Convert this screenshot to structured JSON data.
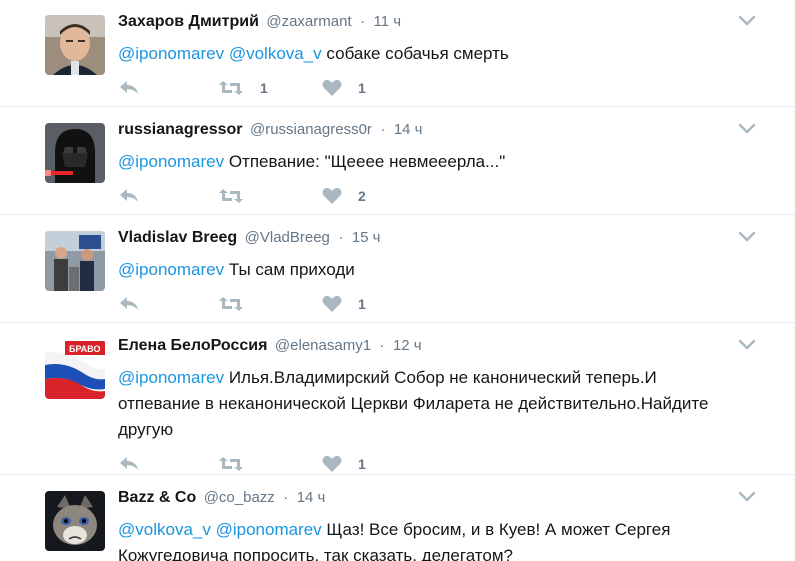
{
  "tweets": [
    {
      "fullname": "Захаров Дмитрий",
      "username": "@zaxarmant",
      "separator": "·",
      "time": "11 ч",
      "mentions": [
        "@iponomarev",
        "@volkova_v"
      ],
      "text": "собаке собачья смерть",
      "text_lines": [],
      "retweets": "1",
      "likes": "1",
      "avatar": "man-photo"
    },
    {
      "fullname": "russianagressor",
      "username": "@russianagress0r",
      "separator": "·",
      "time": "14 ч",
      "mentions": [
        "@iponomarev"
      ],
      "text": "Отпевание: \"Щееее невмееерла...\"",
      "text_lines": [],
      "retweets": "",
      "likes": "2",
      "avatar": "darth-vader"
    },
    {
      "fullname": "Vladislav Breeg",
      "username": "@VladBreeg",
      "separator": "·",
      "time": "15 ч",
      "mentions": [
        "@iponomarev"
      ],
      "text": "Ты сам приходи",
      "text_lines": [],
      "retweets": "",
      "likes": "1",
      "avatar": "people-photo"
    },
    {
      "fullname": "Елена БелоРоссия",
      "username": "@elenasamy1",
      "separator": "·",
      "time": "12 ч",
      "mentions": [
        "@iponomarev"
      ],
      "text": "Илья.Владимирский Собор не канонический теперь.И",
      "text_lines": [
        "отпевание в неканонической Церкви  Филарета не действительно.Найдите",
        "другую"
      ],
      "retweets": "",
      "likes": "1",
      "avatar": "flag-bravo",
      "avatar_label": "БРАВО"
    },
    {
      "fullname": "Bazz & Co",
      "username": "@co_bazz",
      "separator": "·",
      "time": "14 ч",
      "mentions": [
        "@volkova_v",
        "@iponomarev"
      ],
      "text": "Щаз! Все бросим, и в Куев! А может Сергея",
      "text_lines": [
        "Кожугедовича попросить, так сказать, делегатом?"
      ],
      "retweets": "",
      "likes": "",
      "avatar": "grumpy-cat"
    }
  ],
  "colors": {
    "mention": "#1b95e0",
    "secondary": "#657786",
    "icon": "#aab8c2",
    "divider": "#e6ecf0"
  },
  "icons": {
    "reply": "reply-icon",
    "retweet": "retweet-icon",
    "like": "heart-icon",
    "more": "chevron-down-icon"
  }
}
